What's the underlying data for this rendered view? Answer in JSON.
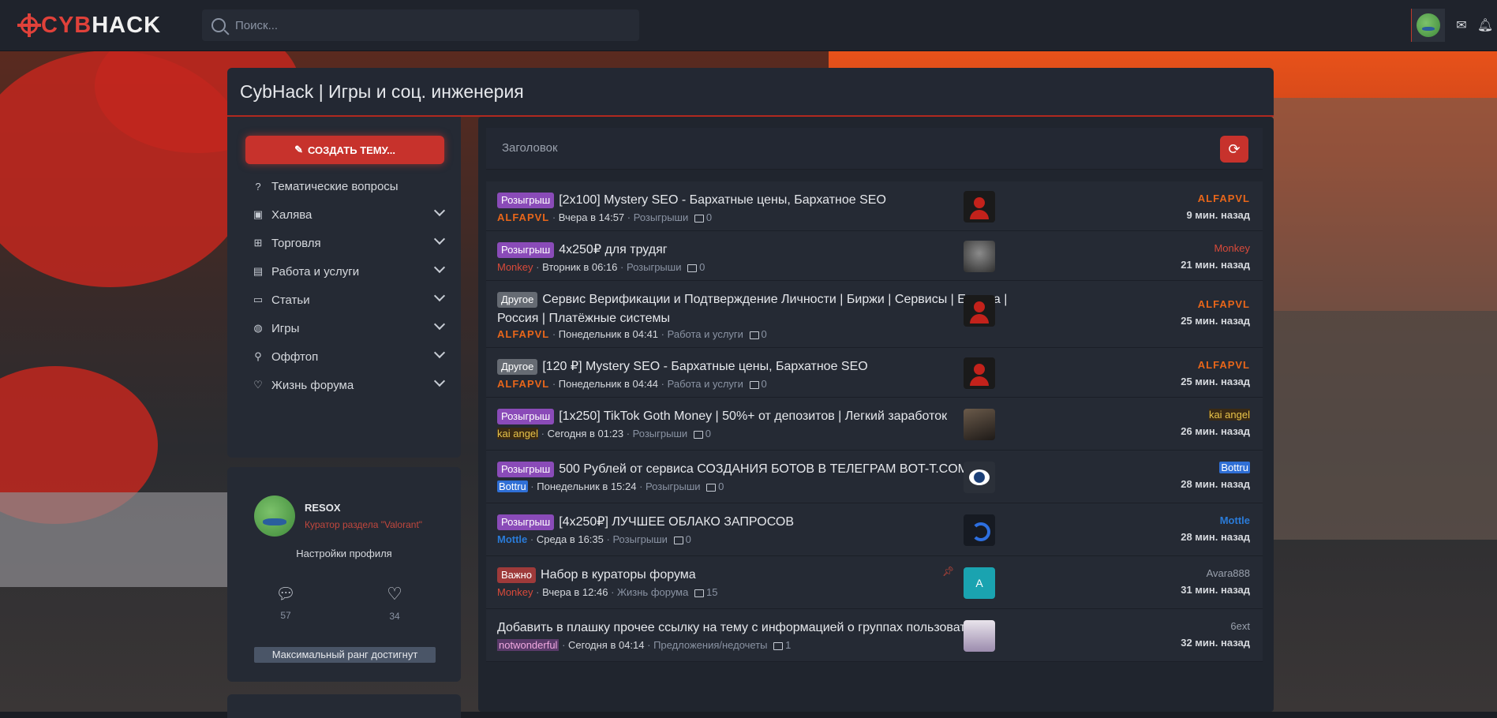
{
  "header": {
    "logo_left": "CYB",
    "logo_right": "HACK",
    "search_placeholder": "Поиск..."
  },
  "forum_title": "CybHack | Игры и соц. инженерия",
  "sidebar": {
    "create_button": "СОЗДАТЬ ТЕМУ...",
    "items": [
      {
        "label": "Тематические вопросы",
        "icon": "question-icon",
        "has_children": false
      },
      {
        "label": "Халява",
        "icon": "gift-icon",
        "has_children": true
      },
      {
        "label": "Торговля",
        "icon": "cart-icon",
        "has_children": true
      },
      {
        "label": "Работа и услуги",
        "icon": "clipboard-icon",
        "has_children": true
      },
      {
        "label": "Статьи",
        "icon": "message-icon",
        "has_children": true
      },
      {
        "label": "Игры",
        "icon": "gamepad-icon",
        "has_children": true
      },
      {
        "label": "Оффтоп",
        "icon": "link-icon",
        "has_children": true
      },
      {
        "label": "Жизнь форума",
        "icon": "heart-icon",
        "has_children": true
      }
    ]
  },
  "profile": {
    "name": "RESOX",
    "role": "Куратор раздела \"Valorant\"",
    "settings_link": "Настройки профиля",
    "messages_count": "57",
    "likes_count": "34",
    "rank": "Максимальный ранг достигнут"
  },
  "threads": {
    "filter_label": "Заголовок",
    "items": [
      {
        "prefix": "Розыгрыш",
        "prefix_type": "giveaway",
        "title": "[2x100] Mystery SEO - Бархатные цены, Бархатное SEO",
        "author": "ALFAPVL",
        "author_style": "alfa",
        "date": "Вчера в 14:57",
        "forum": "Розыгрыши",
        "replies": "0",
        "last_user": "ALFAPVL",
        "last_style": "alfa",
        "last_time": "9 мин. назад",
        "avatar": "red-user-avatar"
      },
      {
        "prefix": "Розыгрыш",
        "prefix_type": "giveaway",
        "title": "4x250₽ для трудяг",
        "author": "Monkey",
        "author_style": "monkey",
        "date": "Вторник в 06:16",
        "forum": "Розыгрыши",
        "replies": "0",
        "last_user": "Monkey",
        "last_style": "monkey",
        "last_time": "21 мин. назад",
        "avatar": "gorilla-avatar"
      },
      {
        "prefix": "Другое",
        "prefix_type": "other",
        "title": "Сервис Верификации и Подтверждение Личности | Биржи | Сервисы | Европа | Россия | Платёжные системы",
        "author": "ALFAPVL",
        "author_style": "alfa",
        "date": "Понедельник в 04:41",
        "forum": "Работа и услуги",
        "replies": "0",
        "last_user": "ALFAPVL",
        "last_style": "alfa",
        "last_time": "25 мин. назад",
        "avatar": "red-user-avatar"
      },
      {
        "prefix": "Другое",
        "prefix_type": "other",
        "title": "[120 ₽] Mystery SEO - Бархатные цены, Бархатное SEO",
        "author": "ALFAPVL",
        "author_style": "alfa",
        "date": "Понедельник в 04:44",
        "forum": "Работа и услуги",
        "replies": "0",
        "last_user": "ALFAPVL",
        "last_style": "alfa",
        "last_time": "25 мин. назад",
        "avatar": "red-user-avatar"
      },
      {
        "prefix": "Розыгрыш",
        "prefix_type": "giveaway",
        "title": "[1x250] TikTok Goth Money | 50%+ от депозитов | Легкий заработок",
        "author": "kai angel",
        "author_style": "kai",
        "date": "Сегодня в 01:23",
        "forum": "Розыгрыши",
        "replies": "0",
        "last_user": "kai angel",
        "last_style": "kai",
        "last_time": "26 мин. назад",
        "avatar": "kai-avatar"
      },
      {
        "prefix": "Розыгрыш",
        "prefix_type": "giveaway",
        "title": "500 Рублей от сервиса СОЗДАНИЯ БОТОВ В ТЕЛЕГРАМ BOT-T.COM",
        "author": "Bottru",
        "author_style": "bottru",
        "date": "Понедельник в 15:24",
        "forum": "Розыгрыши",
        "replies": "0",
        "last_user": "Bottru",
        "last_style": "bottru",
        "last_time": "28 мин. назад",
        "avatar": "bot-avatar"
      },
      {
        "prefix": "Розыгрыш",
        "prefix_type": "giveaway",
        "title": "[4x250₽] ЛУЧШЕЕ ОБЛАКО ЗАПРОСОВ",
        "author": "Mottle",
        "author_style": "mottle",
        "date": "Среда в 16:35",
        "forum": "Розыгрыши",
        "replies": "0",
        "last_user": "Mottle",
        "last_style": "mottle",
        "last_time": "28 мин. назад",
        "avatar": "mottle-avatar"
      },
      {
        "prefix": "Важно",
        "prefix_type": "important",
        "title": "Набор в кураторы форума",
        "author": "Monkey",
        "author_style": "monkey",
        "date": "Вчера в 12:46",
        "forum": "Жизнь форума",
        "replies": "15",
        "last_user": "Avara888",
        "last_style": "avara",
        "last_time": "31 мин. назад",
        "avatar": "letter-a-avatar",
        "avatar_letter": "A",
        "pinned": true
      },
      {
        "prefix": "",
        "prefix_type": "",
        "title": "Добавить в плашку прочее ссылку на тему с информацией о группах пользователей",
        "author": "notwonderful",
        "author_style": "notw",
        "date": "Сегодня в 04:14",
        "forum": "Предложения/недочеты",
        "replies": "1",
        "last_user": "6ext",
        "last_style": "ext",
        "last_time": "32 мин. назад",
        "avatar": "anime-avatar"
      }
    ]
  }
}
